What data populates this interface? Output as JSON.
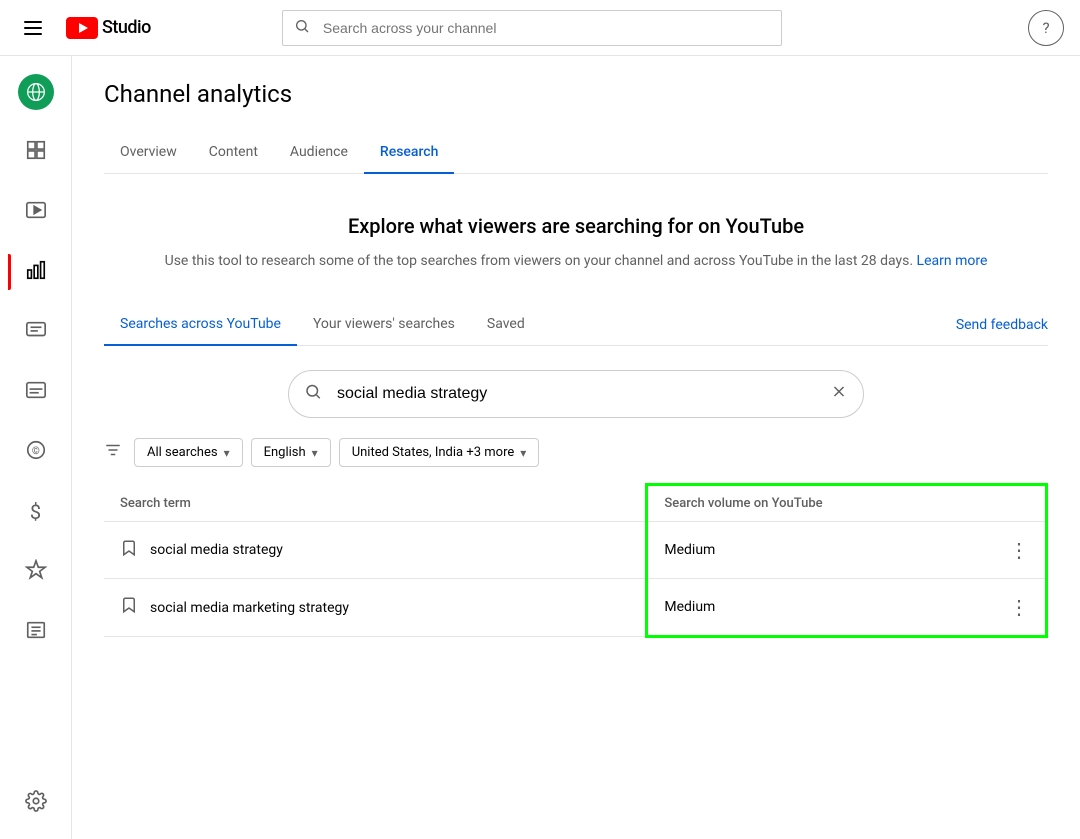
{
  "header": {
    "logo_text": "Studio",
    "search_placeholder": "Search across your channel",
    "help_icon": "?"
  },
  "sidebar": {
    "items": [
      {
        "id": "globe",
        "icon": "🌐",
        "label": "",
        "active": false,
        "globe": true
      },
      {
        "id": "dashboard",
        "icon": "⊞",
        "label": ""
      },
      {
        "id": "video",
        "icon": "▶",
        "label": ""
      },
      {
        "id": "analytics",
        "icon": "📊",
        "label": "",
        "active_red": true
      },
      {
        "id": "comments",
        "icon": "☰",
        "label": ""
      },
      {
        "id": "subtitles",
        "icon": "⬛",
        "label": ""
      },
      {
        "id": "copyright",
        "icon": "©",
        "label": ""
      },
      {
        "id": "monetization",
        "icon": "$",
        "label": ""
      },
      {
        "id": "customise",
        "icon": "✦",
        "label": ""
      },
      {
        "id": "library",
        "icon": "⬜",
        "label": ""
      },
      {
        "id": "settings",
        "icon": "⚙",
        "label": ""
      }
    ]
  },
  "page": {
    "title": "Channel analytics",
    "tabs": [
      {
        "id": "overview",
        "label": "Overview"
      },
      {
        "id": "content",
        "label": "Content"
      },
      {
        "id": "audience",
        "label": "Audience"
      },
      {
        "id": "research",
        "label": "Research",
        "active": true
      }
    ]
  },
  "research": {
    "heading": "Explore what viewers are searching for on YouTube",
    "description": "Use this tool to research some of the top searches from viewers on your channel and across YouTube in the last 28 days.",
    "learn_more": "Learn more",
    "sub_tabs": [
      {
        "id": "searches-across",
        "label": "Searches across YouTube",
        "active": true
      },
      {
        "id": "viewers-searches",
        "label": "Your viewers' searches"
      },
      {
        "id": "saved",
        "label": "Saved"
      }
    ],
    "send_feedback": "Send feedback",
    "search_value": "social media strategy",
    "filters": {
      "icon_label": "filter",
      "all_searches": "All searches",
      "language": "English",
      "location": "United States, India +3 more"
    },
    "table": {
      "col_term": "Search term",
      "col_volume": "Search volume on YouTube",
      "rows": [
        {
          "term": "social media strategy",
          "volume": "Medium"
        },
        {
          "term": "social media marketing strategy",
          "volume": "Medium"
        }
      ]
    }
  }
}
